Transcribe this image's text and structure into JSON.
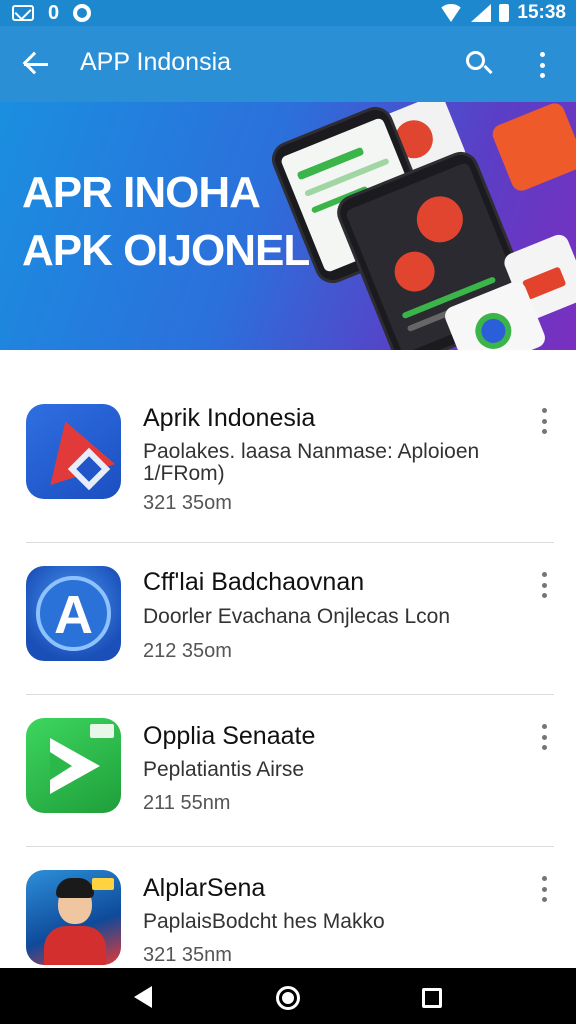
{
  "status_bar": {
    "time": "15:38",
    "left_icons": [
      "mail-icon",
      "o-notification-icon",
      "dot-notification-icon"
    ],
    "left_glyph": "0",
    "right_icons": [
      "wifi-icon",
      "signal-icon",
      "battery-icon"
    ]
  },
  "app_bar": {
    "title": "APP Indonsia",
    "back_icon": "arrow-back-icon",
    "search_icon": "search-icon",
    "more_icon": "more-vert-icon",
    "color": "#2b8fd6"
  },
  "banner": {
    "line1": "APR INOHA",
    "line2": "APK OIJONEL",
    "gradient_start": "#1a8fe0",
    "gradient_end": "#7a2fc0"
  },
  "apps": [
    {
      "name": "Aprik Indonesia",
      "desc_line1": "Paolakes. laasa Nanmase: Aploioen",
      "desc_line2": "1/FRom)",
      "size": "321 35om",
      "icon": "red-blue-a-app-icon"
    },
    {
      "name": "Cff'lai Badchaovnan",
      "desc_line1": "Doorler Evachana Onjlecas Lcon",
      "size": "212 35om",
      "icon": "blue-a-circle-app-icon"
    },
    {
      "name": "Opplia Senaate",
      "desc_line1": "Peplatiantis Airse",
      "size": "211 55nm",
      "icon": "green-arrow-app-icon"
    },
    {
      "name": "AlplarSena",
      "desc_line1": "PaplaisBodcht hes Makko",
      "size": "321 35nm",
      "icon": "person-portrait-app-icon"
    }
  ],
  "nav_bar": {
    "icons": [
      "nav-back-icon",
      "nav-home-icon",
      "nav-recents-icon"
    ]
  }
}
